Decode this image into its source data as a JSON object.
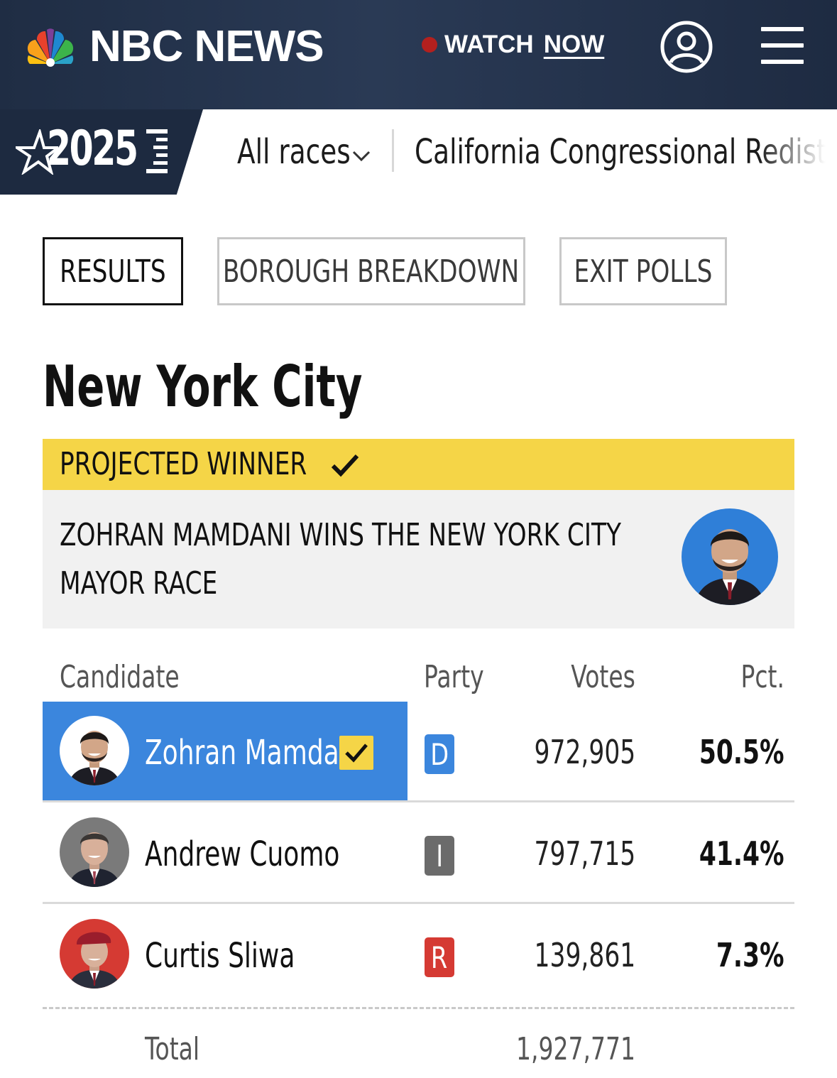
{
  "header": {
    "brand": "NBC NEWS",
    "watch_label": "WATCH",
    "watch_now_label": "NOW"
  },
  "subnav": {
    "year": "2025",
    "all_races": "All races",
    "race_link": "California Congressional Redistri"
  },
  "tabs": [
    {
      "label": "RESULTS",
      "active": true
    },
    {
      "label": "BOROUGH BREAKDOWN",
      "active": false
    },
    {
      "label": "EXIT POLLS",
      "active": false
    }
  ],
  "race": {
    "title": "New York City",
    "winner_label": "PROJECTED WINNER",
    "winner_headline": "ZOHRAN MAMDANI WINS THE NEW YORK CITY MAYOR RACE"
  },
  "table": {
    "headers": {
      "candidate": "Candidate",
      "party": "Party",
      "votes": "Votes",
      "pct": "Pct."
    },
    "rows": [
      {
        "name": "Zohran Mamdani",
        "party": "D",
        "votes": "972,905",
        "pct": "50.5%"
      },
      {
        "name": "Andrew Cuomo",
        "party": "I",
        "votes": "797,715",
        "pct": "41.4%"
      },
      {
        "name": "Curtis Sliwa",
        "party": "R",
        "votes": "139,861",
        "pct": "7.3%"
      }
    ],
    "total_label": "Total",
    "total_votes": "1,927,771"
  },
  "colors": {
    "header_bg": "#1f2d44",
    "winner_yellow": "#f5d547",
    "leader_blue": "#3b86dd",
    "democrat": "#3b86dd",
    "independent": "#6b6b6b",
    "republican": "#d53a33"
  }
}
